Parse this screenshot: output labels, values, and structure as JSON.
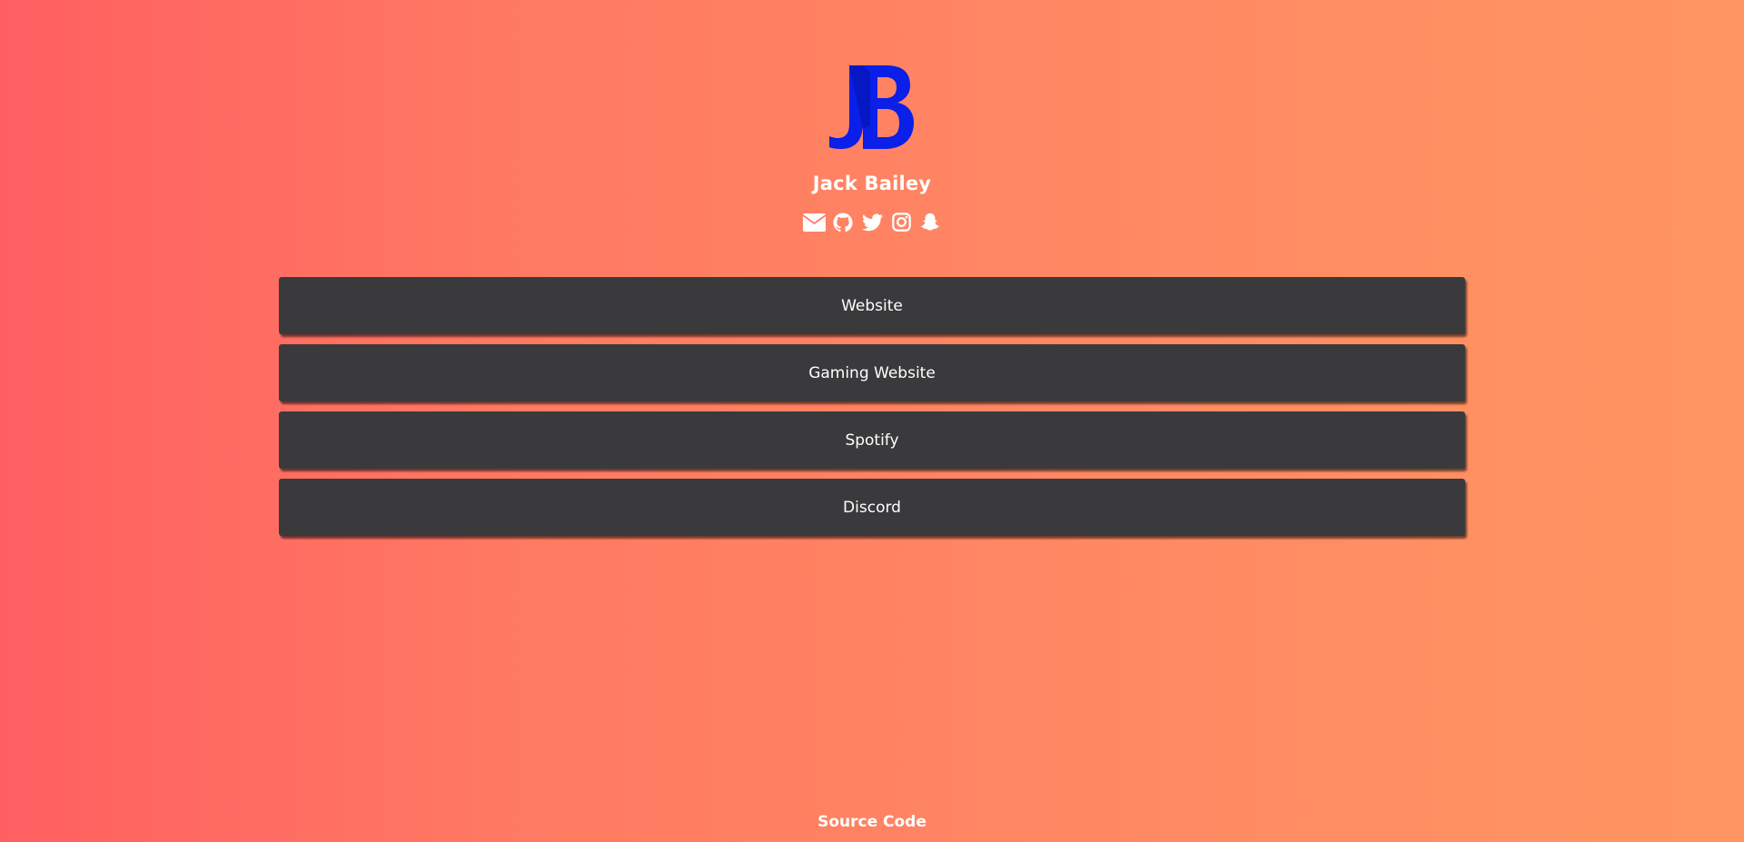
{
  "profile": {
    "logo_icon": "jb-monogram-logo",
    "name": "Jack Bailey"
  },
  "socials": [
    {
      "icon": "envelope-icon"
    },
    {
      "icon": "github-icon"
    },
    {
      "icon": "twitter-icon"
    },
    {
      "icon": "instagram-icon"
    },
    {
      "icon": "snapchat-icon"
    }
  ],
  "links": [
    {
      "label": "Website"
    },
    {
      "label": "Gaming Website"
    },
    {
      "label": "Spotify"
    },
    {
      "label": "Discord"
    }
  ],
  "footer": {
    "label": "Source Code"
  },
  "colors": {
    "gradient_start": "#ff5f61",
    "gradient_end": "#ff9662",
    "button_bg": "#3a3a3c",
    "logo_blue": "#0a1fe8"
  }
}
